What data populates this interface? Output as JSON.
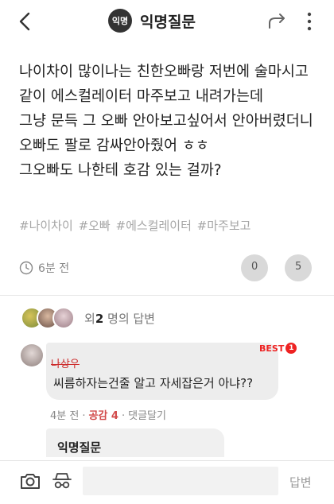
{
  "header": {
    "logo_text": "익명",
    "title": "익명질문",
    "icons": [
      "back-icon",
      "share-icon",
      "more-vertical-icon"
    ]
  },
  "question": {
    "body": "나이차이 많이나는 친한오빠랑 저번에 술마시고 같이 에스컬레이터 마주보고 내려가는데\n그냥 문득 그 오빠 안아보고싶어서 안아버렸더니 오빠도 팔로 감싸안아줬어 ㅎㅎ\n그오빠도 나한테 호감 있는 걸까?",
    "tags": [
      "#나이차이",
      "#오빠",
      "#에스컬레이터",
      "#마주보고"
    ],
    "time": "6분 전",
    "likes": "0",
    "comments": "5"
  },
  "answers": {
    "count_prefix": "외",
    "count": "2",
    "count_suffix": " 명의 답변",
    "reply": {
      "name": "나상우",
      "best_label": "BEST",
      "best_num": "1",
      "text": "씨름하자는건줄 알고 자세잡은거 아냐??",
      "time": "4분 전",
      "sympathy_label": "공감 4",
      "reply_label": "댓글달기"
    },
    "quote_title": "익명질문"
  },
  "bottom_bar": {
    "input_placeholder": "",
    "send_label": "답변",
    "icons": [
      "camera-icon",
      "anonymous-mask-icon"
    ]
  },
  "colors": {
    "best_red": "#ee2222",
    "sympathy_red": "#d24b4b",
    "tag_gray": "#a6a6a6"
  }
}
